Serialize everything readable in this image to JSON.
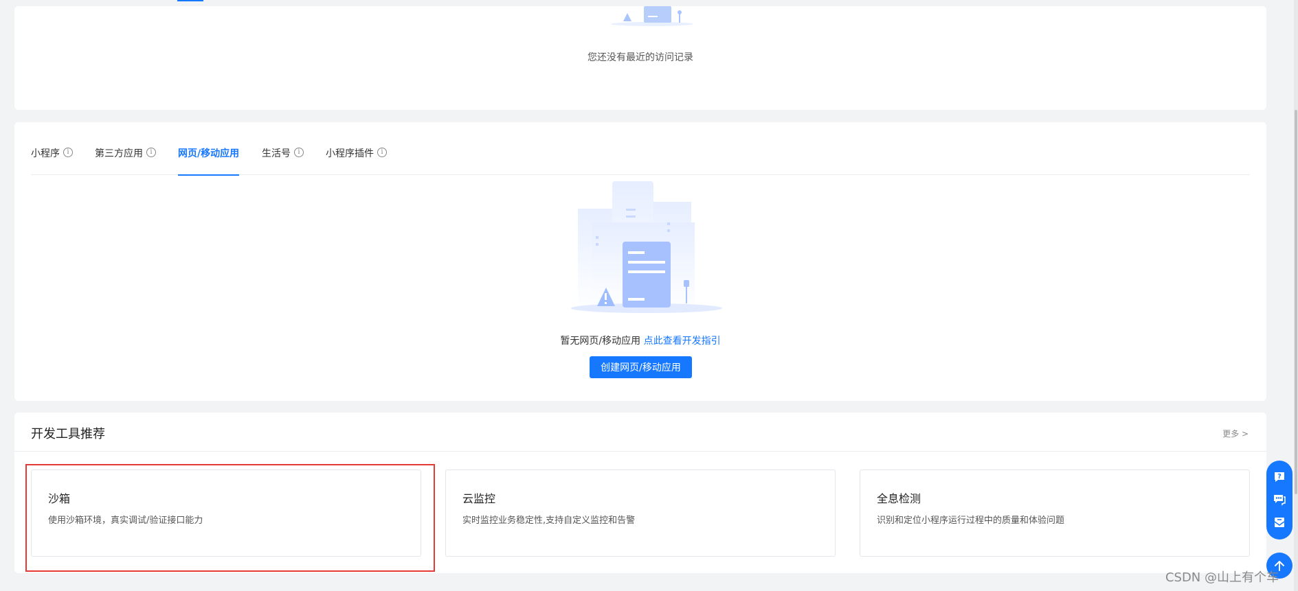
{
  "recent": {
    "empty_text": "您还没有最近的访问记录"
  },
  "apps": {
    "tabs": [
      {
        "label": "小程序",
        "info": "i"
      },
      {
        "label": "第三方应用",
        "info": "i"
      },
      {
        "label": "网页/移动应用",
        "active": true
      },
      {
        "label": "生活号",
        "info": "i"
      },
      {
        "label": "小程序插件",
        "info": "i"
      }
    ],
    "empty_text": "暂无网页/移动应用",
    "guide_link": "点此查看开发指引",
    "create_button": "创建网页/移动应用"
  },
  "tools": {
    "title": "开发工具推荐",
    "more": "更多 >",
    "items": [
      {
        "name": "沙箱",
        "desc": "使用沙箱环境，真实调试/验证接口能力"
      },
      {
        "name": "云监控",
        "desc": "实时监控业务稳定性,支持自定义监控和告警"
      },
      {
        "name": "全息检测",
        "desc": "识别和定位小程序运行过程中的质量和体验问题"
      }
    ]
  },
  "float_bar": {
    "icons": [
      "help-icon",
      "chat-icon",
      "feedback-icon"
    ],
    "back_top": "arrow-up-icon"
  },
  "watermark": "CSDN @山上有个车",
  "colors": {
    "accent": "#1677ff",
    "highlight": "#e53935",
    "background": "#f2f3f5"
  }
}
